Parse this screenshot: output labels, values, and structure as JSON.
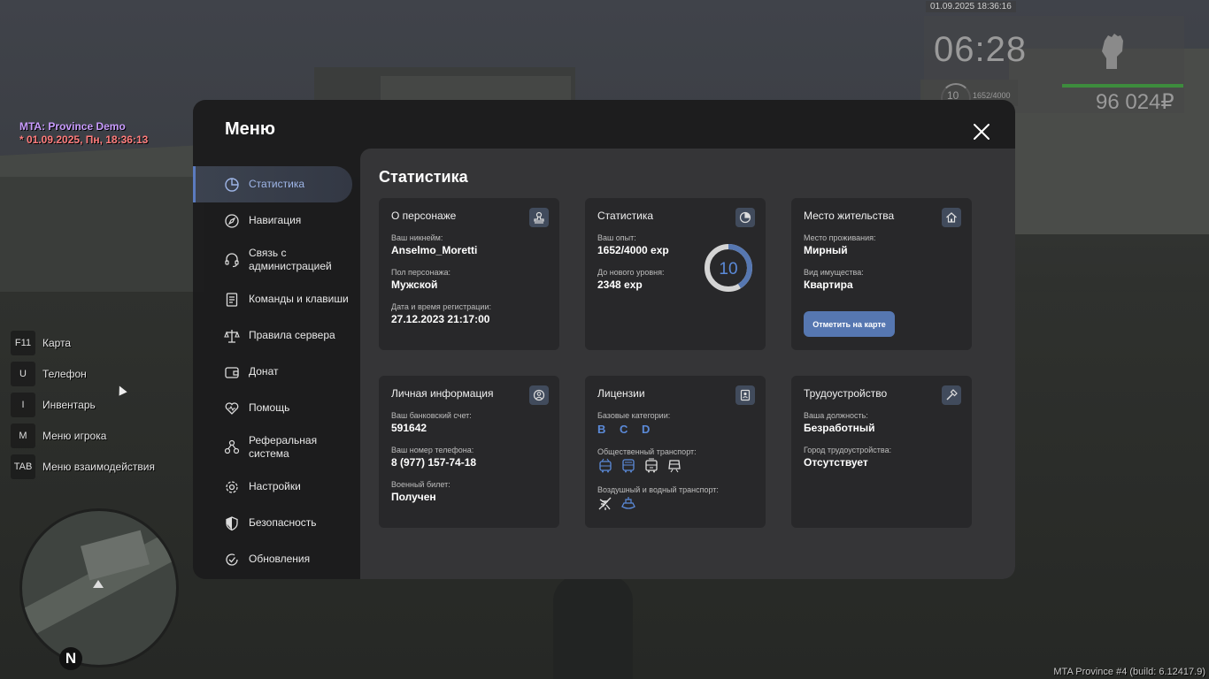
{
  "hud": {
    "server_name": "MTA: Province Demo",
    "server_datetime": "* 01.09.2025, Пн, 18:36:13",
    "timestamp": "01.09.2025 18:36:16",
    "clock": "06:28",
    "level": "10",
    "exp": "1652/4000",
    "money": "96 024₽",
    "build": "MTA Province #4 (build: 6.12417.9)",
    "compass": "N"
  },
  "hotkeys": [
    {
      "key": "F11",
      "label": "Карта"
    },
    {
      "key": "U",
      "label": "Телефон"
    },
    {
      "key": "I",
      "label": "Инвентарь"
    },
    {
      "key": "M",
      "label": "Меню игрока"
    },
    {
      "key": "TAB",
      "label": "Меню взаимодействия"
    }
  ],
  "menu": {
    "title": "Меню",
    "sidebar": [
      {
        "label": "Статистика",
        "icon": "chart-pie-icon",
        "active": true
      },
      {
        "label": "Навигация",
        "icon": "compass-icon"
      },
      {
        "label": "Связь с администрацией",
        "icon": "headset-icon"
      },
      {
        "label": "Команды и клавиши",
        "icon": "document-icon"
      },
      {
        "label": "Правила сервера",
        "icon": "scales-icon"
      },
      {
        "label": "Донат",
        "icon": "wallet-icon"
      },
      {
        "label": "Помощь",
        "icon": "heart-icon"
      },
      {
        "label": "Реферальная система",
        "icon": "referral-icon"
      },
      {
        "label": "Настройки",
        "icon": "gear-icon"
      },
      {
        "label": "Безопасность",
        "icon": "shield-icon"
      },
      {
        "label": "Обновления",
        "icon": "refresh-icon"
      }
    ]
  },
  "content": {
    "title": "Статистика",
    "character": {
      "title": "О персонаже",
      "nick_label": "Ваш никнейм:",
      "nick": "Anselmo_Moretti",
      "gender_label": "Пол персонажа:",
      "gender": "Мужской",
      "reg_label": "Дата и время регистрации:",
      "reg": "27.12.2023 21:17:00"
    },
    "stats": {
      "title": "Статистика",
      "exp_label": "Ваш опыт:",
      "exp": "1652/4000 exp",
      "next_label": "До нового уровня:",
      "next": "2348 exp",
      "level": "10",
      "progress": 0.413
    },
    "residence": {
      "title": "Место жительства",
      "place_label": "Место проживания:",
      "place": "Мирный",
      "type_label": "Вид имущества:",
      "type": "Квартира",
      "button": "Отметить на карте"
    },
    "personal": {
      "title": "Личная информация",
      "bank_label": "Ваш банковский счет:",
      "bank": "591642",
      "phone_label": "Ваш номер телефона:",
      "phone": "8 (977) 157-74-18",
      "military_label": "Военный билет:",
      "military": "Получен"
    },
    "licenses": {
      "title": "Лицензии",
      "base_label": "Базовые категории:",
      "categories": [
        "B",
        "C",
        "D"
      ],
      "public_label": "Общественный транспорт:",
      "air_label": "Воздушный и водный транспорт:"
    },
    "employment": {
      "title": "Трудоустройство",
      "position_label": "Ваша должность:",
      "position": "Безработный",
      "city_label": "Город трудоустройства:",
      "city": "Отсутствует"
    }
  },
  "colors": {
    "accent": "#5677b1",
    "category_blue": "#5b8ad9",
    "card_bg": "#28282a",
    "panel_bg": "#353537"
  }
}
